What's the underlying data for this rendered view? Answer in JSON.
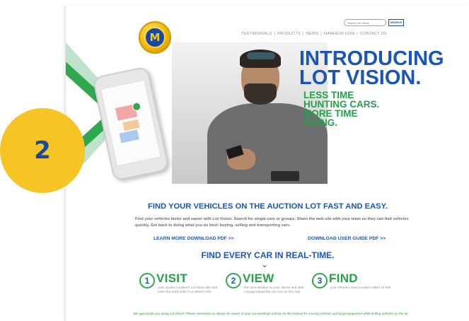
{
  "badge": {
    "number": "2"
  },
  "logo": {
    "letter": "M"
  },
  "search": {
    "placeholder": "Search the News",
    "button_label": "SEARCH"
  },
  "nav": {
    "items": [
      "TESTIMONIALS",
      "PRODUCTS",
      "NEWS",
      "MANHEIM.COM",
      "CONTACT US"
    ],
    "separator": "|"
  },
  "hero": {
    "headline_line1": "INTRODUCING",
    "headline_line2": "LOT VISION.",
    "sub_line1": "LESS TIME",
    "sub_line2": "HUNTING CARS.",
    "sub_line3": "MORE TIME",
    "sub_line4": "DOING."
  },
  "main": {
    "title": "FIND YOUR VEHICLES ON THE AUCTION LOT FAST AND EASY.",
    "intro": "Find your vehicles faster and easier with Lot Vision. Search for single cars or groups. Share the web site with your team so they can find vehicles quickly. Get back to doing what you do best: buying, selling and transporting cars.",
    "learn_more_link": "LEARN MORE DOWNLOAD PDF >>",
    "user_guide_link": "DOWNLOAD USER GUIDE PDF >>",
    "section_title": "FIND EVERY CAR IN REAL-TIME.",
    "chevron": "⌄"
  },
  "steps": [
    {
      "num": "1",
      "title": "VISIT",
      "desc": "your auction location's Lot Vision site and enter the work order # or vehicle VIN"
    },
    {
      "num": "2",
      "title": "VIEW",
      "desc": "the car's location on your device and start moving toward the car icon on the map."
    },
    {
      "num": "3",
      "title": "FIND",
      "desc": "your vehicle's exact location within 10 feet"
    }
  ],
  "footer_note": "We appreciate you using Lot Vision! Please remember to always be aware of your surroundings and be on the lookout for moving vehicles and large equipment while finding vehicles on the lot.",
  "colors": {
    "brand_blue": "#1a56b8",
    "brand_green": "#25a04a",
    "badge_yellow": "#f7c425"
  }
}
